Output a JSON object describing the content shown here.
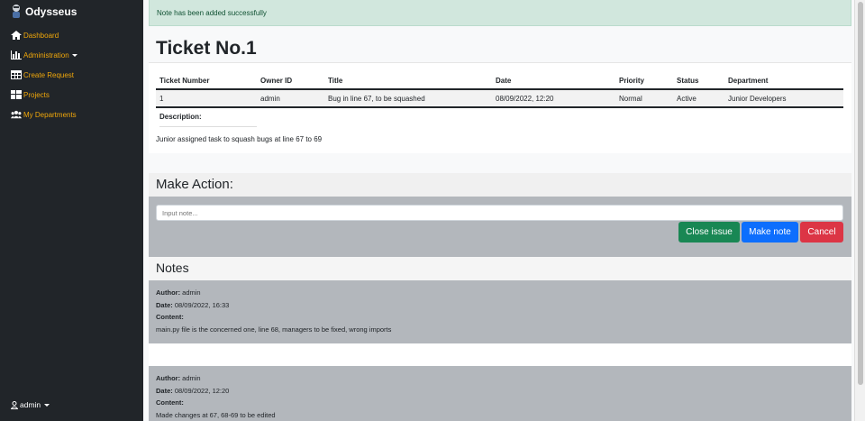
{
  "sidebar": {
    "brand": "Odysseus",
    "items": [
      {
        "label": "Dashboard",
        "icon": "home-icon"
      },
      {
        "label": "Administration",
        "icon": "bar-chart-icon"
      },
      {
        "label": "Create Request",
        "icon": "table-icon"
      },
      {
        "label": "Projects",
        "icon": "grid-icon"
      },
      {
        "label": "My Departments",
        "icon": "users-icon"
      }
    ],
    "user": "admin"
  },
  "alert": "Note has been added successfully",
  "ticket": {
    "title": "Ticket No.1",
    "columns": [
      "Ticket Number",
      "Owner ID",
      "Title",
      "Date",
      "Priority",
      "Status",
      "Department"
    ],
    "row": [
      "1",
      "admin",
      "Bug in line 67, to be squashed",
      "08/09/2022, 12:20",
      "Normal",
      "Active",
      "Junior Developers"
    ],
    "description_label": "Description:",
    "description": "Junior assigned task to squash bugs at line 67 to 69"
  },
  "action": {
    "title": "Make Action:",
    "placeholder": "Input note...",
    "close_label": "Close issue",
    "note_label": "Make note",
    "cancel_label": "Cancel"
  },
  "notes": {
    "title": "Notes",
    "author_label": "Author:",
    "date_label": "Date:",
    "content_label": "Content:",
    "items": [
      {
        "author": "admin",
        "date": "08/09/2022, 16:33",
        "content": "main.py file is the concerned one, line 68, managers to be fixed, wrong imports"
      },
      {
        "author": "admin",
        "date": "08/09/2022, 12:20",
        "content": "Made changes at 67, 68-69 to be edited"
      }
    ]
  },
  "colors": {
    "sidebar_bg": "#212529",
    "nav_accent": "#f0a70a",
    "success_btn": "#198754",
    "primary_btn": "#0d6efd",
    "danger_btn": "#dc3545"
  }
}
